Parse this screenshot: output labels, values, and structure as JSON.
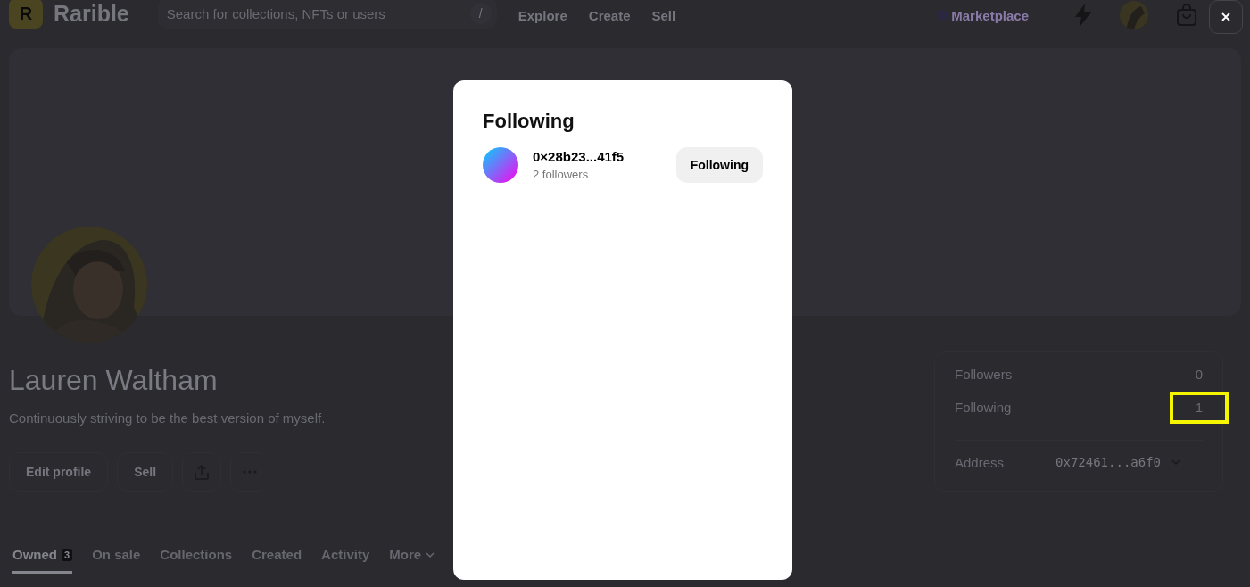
{
  "header": {
    "logo_letter": "R",
    "brand": "Rarible",
    "search": {
      "placeholder": "Search for collections, NFTs or users",
      "shortcut": "/"
    },
    "nav": [
      "Explore",
      "Create",
      "Sell"
    ],
    "marketplace": "Marketplace"
  },
  "profile": {
    "name": "Lauren Waltham",
    "bio": "Continuously striving to be the best version of myself.",
    "actions": [
      {
        "kind": "text",
        "label": "Edit profile"
      },
      {
        "kind": "text",
        "label": "Sell"
      },
      {
        "kind": "share"
      },
      {
        "kind": "more"
      }
    ]
  },
  "stats": [
    {
      "label": "Followers",
      "value": "0",
      "highlighted": false
    },
    {
      "label": "Following",
      "value": "1",
      "highlighted": true
    }
  ],
  "address": {
    "label": "Address",
    "value": "0x72461...a6f0"
  },
  "tabs": [
    {
      "label": "Owned",
      "count": "3",
      "selected": true
    },
    {
      "label": "On sale",
      "selected": false
    },
    {
      "label": "Collections",
      "selected": false
    },
    {
      "label": "Created",
      "selected": false
    },
    {
      "label": "Activity",
      "selected": false
    },
    {
      "label": "More",
      "selected": false,
      "dropdown": true
    }
  ],
  "modal": {
    "title": "Following",
    "users": [
      {
        "name": "0×28b23...41f5",
        "followers": "2 followers",
        "button": "Following"
      }
    ]
  }
}
